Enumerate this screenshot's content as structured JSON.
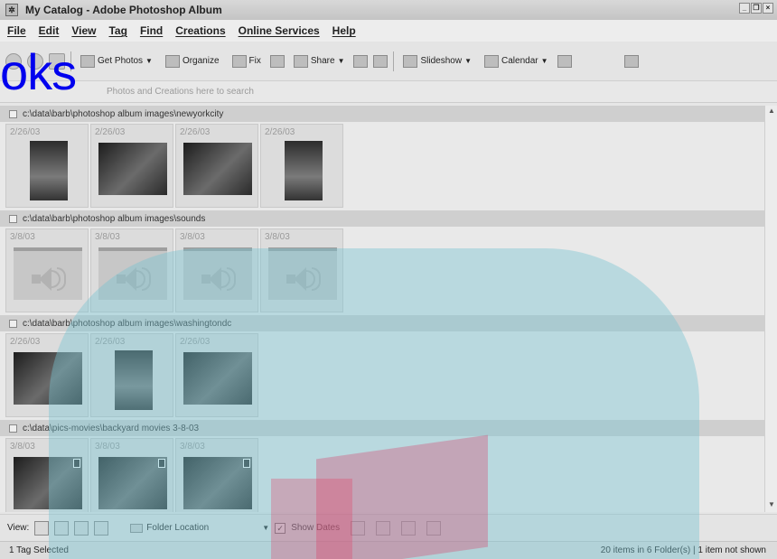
{
  "window": {
    "title": "My Catalog - Adobe Photoshop Album"
  },
  "menu": [
    "File",
    "Edit",
    "View",
    "Tag",
    "Find",
    "Creations",
    "Online Services",
    "Help"
  ],
  "toolbar": {
    "get_photos": "Get Photos",
    "organize": "Organize",
    "fix": "Fix",
    "share": "Share",
    "slideshow": "Slideshow",
    "calendar": "Calendar"
  },
  "overlay_logo": "oks",
  "findbar": {
    "hint": "Photos and Creations here to search"
  },
  "folders": [
    {
      "path": "c:\\data\\barb\\photoshop album images\\newyorkcity",
      "items": [
        {
          "date": "2/26/03",
          "kind": "photo-tall"
        },
        {
          "date": "2/26/03",
          "kind": "photo"
        },
        {
          "date": "2/26/03",
          "kind": "photo"
        },
        {
          "date": "2/26/03",
          "kind": "photo-tall"
        }
      ]
    },
    {
      "path": "c:\\data\\barb\\photoshop album images\\sounds",
      "items": [
        {
          "date": "3/8/03",
          "kind": "sound"
        },
        {
          "date": "3/8/03",
          "kind": "sound"
        },
        {
          "date": "3/8/03",
          "kind": "sound"
        },
        {
          "date": "3/8/03",
          "kind": "sound"
        }
      ]
    },
    {
      "path": "c:\\data\\barb\\photoshop album images\\washingtondc",
      "items": [
        {
          "date": "2/26/03",
          "kind": "photo"
        },
        {
          "date": "2/26/03",
          "kind": "photo-tall"
        },
        {
          "date": "2/26/03",
          "kind": "photo"
        }
      ]
    },
    {
      "path": "c:\\data\\pics-movies\\backyard movies 3-8-03",
      "items": [
        {
          "date": "3/8/03",
          "kind": "video"
        },
        {
          "date": "3/8/03",
          "kind": "video"
        },
        {
          "date": "3/8/03",
          "kind": "video"
        }
      ]
    }
  ],
  "bottom": {
    "view_label": "View:",
    "folder_location": "Folder Location",
    "show_dates": "Show Dates"
  },
  "status": {
    "left": "1 Tag Selected",
    "right": "20 items in 6 Folder(s)  |  1 item not shown"
  }
}
